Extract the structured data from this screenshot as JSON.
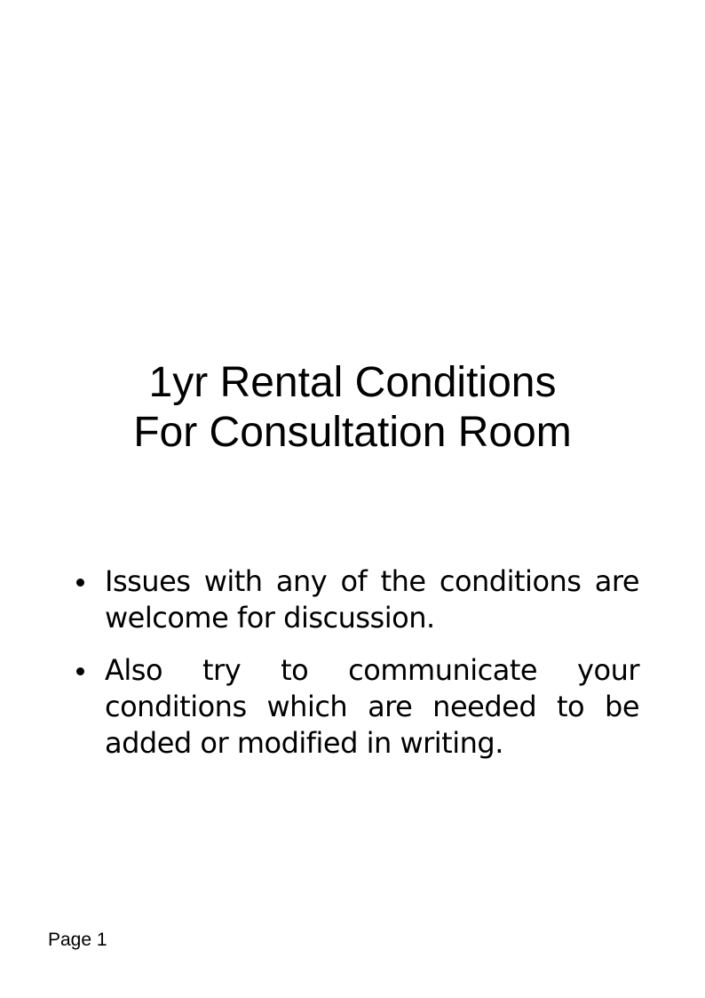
{
  "document": {
    "title_line_1": "1yr Rental Conditions",
    "title_line_2": "For Consultation Room",
    "bullets": [
      "Issues with any of the conditions are welcome for discussion.",
      "Also try to communicate your conditions which are needed to be added or modified in writing."
    ],
    "footer": "Page 1"
  }
}
